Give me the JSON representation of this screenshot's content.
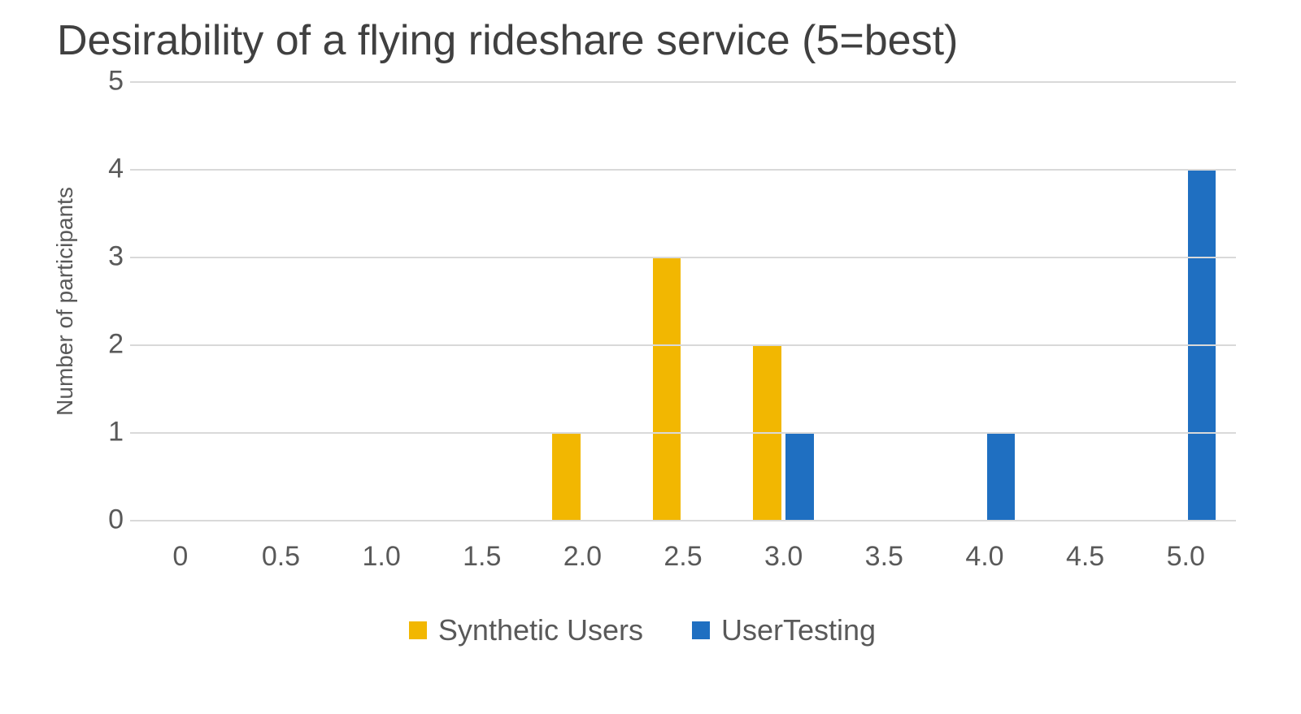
{
  "chart_data": {
    "type": "bar",
    "title": "Desirability of a flying rideshare service (5=best)",
    "ylabel": "Number of participants",
    "xlabel": "",
    "ylim": [
      0,
      5
    ],
    "yticks": [
      0,
      1,
      2,
      3,
      4,
      5
    ],
    "categories": [
      "0",
      "0.5",
      "1.0",
      "1.5",
      "2.0",
      "2.5",
      "3.0",
      "3.5",
      "4.0",
      "4.5",
      "5.0"
    ],
    "series": [
      {
        "name": "Synthetic Users",
        "color": "#f2b701",
        "values": [
          0,
          0,
          0,
          0,
          1,
          3,
          2,
          0,
          0,
          0,
          0
        ]
      },
      {
        "name": "UserTesting",
        "color": "#1f6fc1",
        "values": [
          0,
          0,
          0,
          0,
          0,
          0,
          1,
          0,
          1,
          0,
          4
        ]
      }
    ]
  }
}
